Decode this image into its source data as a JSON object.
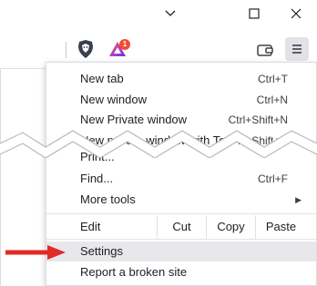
{
  "window_controls": {
    "minimize_icon": "chevron-down-icon",
    "maximize_icon": "square-icon",
    "close_icon": "close-icon"
  },
  "toolbar": {
    "shield_icon": "brave-shield-icon",
    "rewards_icon": "brave-rewards-icon",
    "rewards_badge": "1",
    "wallet_icon": "wallet-icon",
    "menu_icon": "hamburger-menu-icon"
  },
  "menu": {
    "items": [
      {
        "label": "New tab",
        "shortcut": "Ctrl+T"
      },
      {
        "label": "New window",
        "shortcut": "Ctrl+N"
      },
      {
        "label": "New Private window",
        "shortcut": "Ctrl+Shift+N"
      },
      {
        "label": "New private window with Tor",
        "shortcut": "Alt+Shift+N"
      },
      {
        "label": "Print...",
        "shortcut": ""
      },
      {
        "label": "Find...",
        "shortcut": "Ctrl+F"
      },
      {
        "label": "More tools",
        "shortcut": ""
      }
    ],
    "edit": {
      "label": "Edit",
      "cut": "Cut",
      "copy": "Copy",
      "paste": "Paste"
    },
    "settings": "Settings",
    "report": "Report a broken site"
  },
  "colors": {
    "menu_highlight": "#e8e8ec",
    "arrow": "#e02b27",
    "brave_orange": "#fb542b"
  }
}
